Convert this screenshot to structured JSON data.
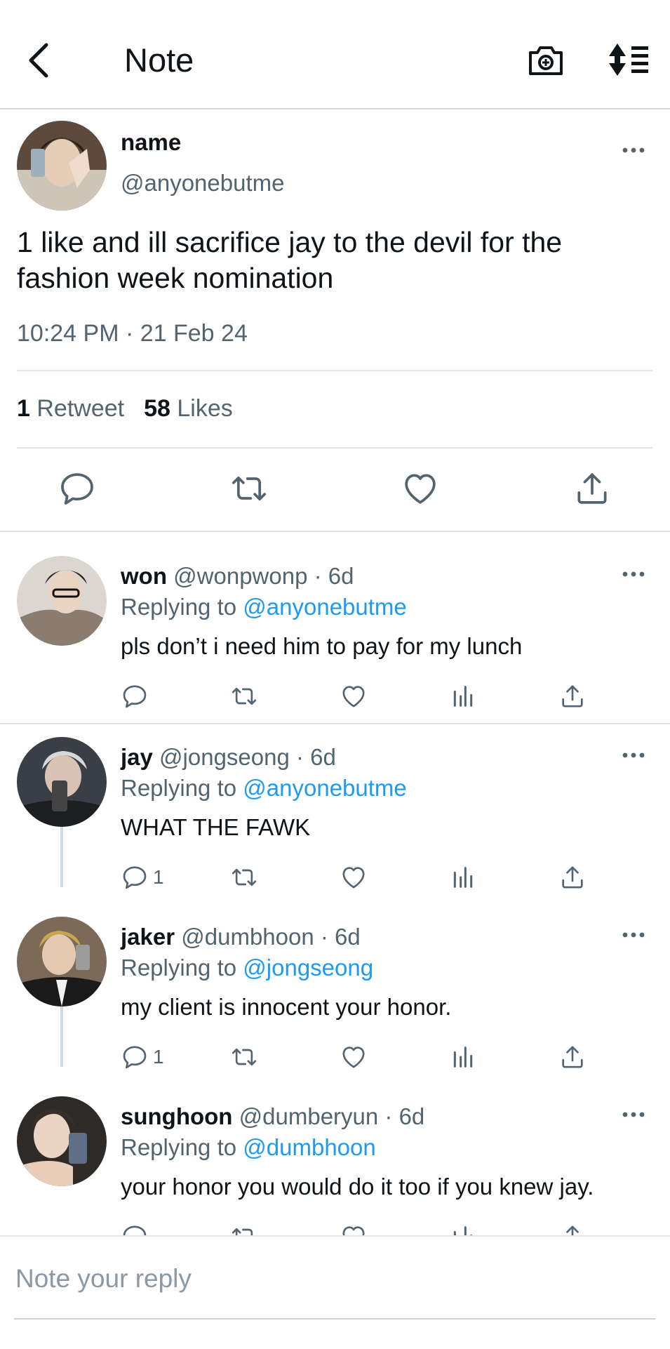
{
  "header": {
    "title": "Note"
  },
  "note": {
    "name": "name",
    "handle": "@anyonebutme",
    "text": "1 like and ill sacrifice jay to the devil for the fashion week nomination",
    "time": "10:24 PM · 21 Feb 24",
    "retweets_count": "1",
    "retweets_label": "Retweet",
    "likes_count": "58",
    "likes_label": "Likes"
  },
  "replies": [
    {
      "name": "won",
      "handle": "@wonpwonp · 6d",
      "replying_label": "Replying to",
      "replying_to": "@anyonebutme",
      "text": "pls don’t i need him to pay for my lunch",
      "reply_count": ""
    },
    {
      "name": "jay",
      "handle": "@jongseong · 6d",
      "replying_label": "Replying to",
      "replying_to": "@anyonebutme",
      "text": "WHAT THE FAWK",
      "reply_count": "1"
    },
    {
      "name": "jaker",
      "handle": "@dumbhoon · 6d",
      "replying_label": "Replying to",
      "replying_to": "@jongseong",
      "text": "my client is innocent your honor.",
      "reply_count": "1"
    },
    {
      "name": "sunghoon",
      "handle": "@dumberyun · 6d",
      "replying_label": "Replying to",
      "replying_to": "@dumbhoon",
      "text": "your honor you would do it too if you knew jay.",
      "reply_count": ""
    }
  ],
  "reply_box": {
    "placeholder": "Note your reply"
  },
  "colors": {
    "accent": "#1d9bf0",
    "secondary_text": "#536471",
    "icon": "#536471"
  }
}
